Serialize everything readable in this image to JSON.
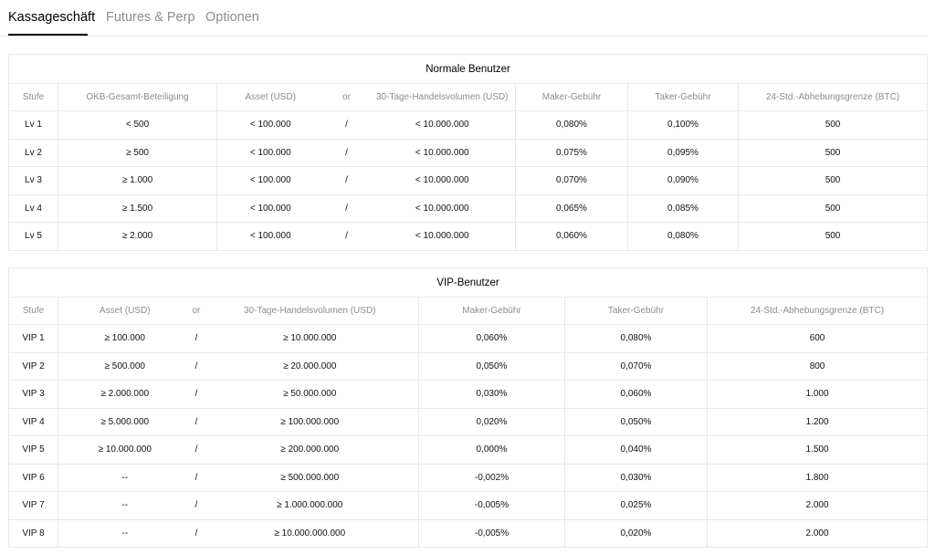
{
  "tabs": [
    {
      "label": "Kassageschäft",
      "active": true
    },
    {
      "label": "Futures & Perp",
      "active": false
    },
    {
      "label": "Optionen",
      "active": false
    }
  ],
  "normal": {
    "title": "Normale Benutzer",
    "headers": [
      "Stufe",
      "OKB-Gesamt-Beteiligung",
      "Asset (USD)",
      "or",
      "30-Tage-Handelsvolumen (USD)",
      "Maker-Gebühr",
      "Taker-Gebühr",
      "24-Std.-Abhebungsgrenze (BTC)"
    ],
    "rows": [
      [
        "Lv 1",
        "< 500",
        "< 100.000",
        "/",
        "< 10.000.000",
        "0,080%",
        "0,100%",
        "500"
      ],
      [
        "Lv 2",
        "≥ 500",
        "< 100.000",
        "/",
        "< 10.000.000",
        "0,075%",
        "0,095%",
        "500"
      ],
      [
        "Lv 3",
        "≥ 1.000",
        "< 100.000",
        "/",
        "< 10.000.000",
        "0,070%",
        "0,090%",
        "500"
      ],
      [
        "Lv 4",
        "≥ 1.500",
        "< 100.000",
        "/",
        "< 10.000.000",
        "0,065%",
        "0,085%",
        "500"
      ],
      [
        "Lv 5",
        "≥ 2.000",
        "< 100.000",
        "/",
        "< 10.000.000",
        "0,060%",
        "0,080%",
        "500"
      ]
    ]
  },
  "vip": {
    "title": "VIP-Benutzer",
    "headers": [
      "Stufe",
      "Asset (USD)",
      "or",
      "30-Tage-Handelsvolumen (USD)",
      "Maker-Gebühr",
      "Taker-Gebühr",
      "24-Std.-Abhebungsgrenze (BTC)"
    ],
    "rows": [
      [
        "VIP 1",
        "≥ 100.000",
        "/",
        "≥ 10.000.000",
        "0,060%",
        "0,080%",
        "600"
      ],
      [
        "VIP 2",
        "≥ 500.000",
        "/",
        "≥ 20.000.000",
        "0,050%",
        "0,070%",
        "800"
      ],
      [
        "VIP 3",
        "≥ 2.000.000",
        "/",
        "≥ 50.000.000",
        "0,030%",
        "0,060%",
        "1.000"
      ],
      [
        "VIP 4",
        "≥ 5.000.000",
        "/",
        "≥ 100.000.000",
        "0,020%",
        "0,050%",
        "1.200"
      ],
      [
        "VIP 5",
        "≥ 10.000.000",
        "/",
        "≥ 200.000.000",
        "0,000%",
        "0,040%",
        "1.500"
      ],
      [
        "VIP 6",
        "--",
        "/",
        "≥ 500.000.000",
        "-0,002%",
        "0,030%",
        "1.800"
      ],
      [
        "VIP 7",
        "--",
        "/",
        "≥ 1.000.000.000",
        "-0,005%",
        "0,025%",
        "2.000"
      ],
      [
        "VIP 8",
        "--",
        "/",
        "≥ 10.000.000.000",
        "-0,005%",
        "0,020%",
        "2.000"
      ]
    ]
  }
}
